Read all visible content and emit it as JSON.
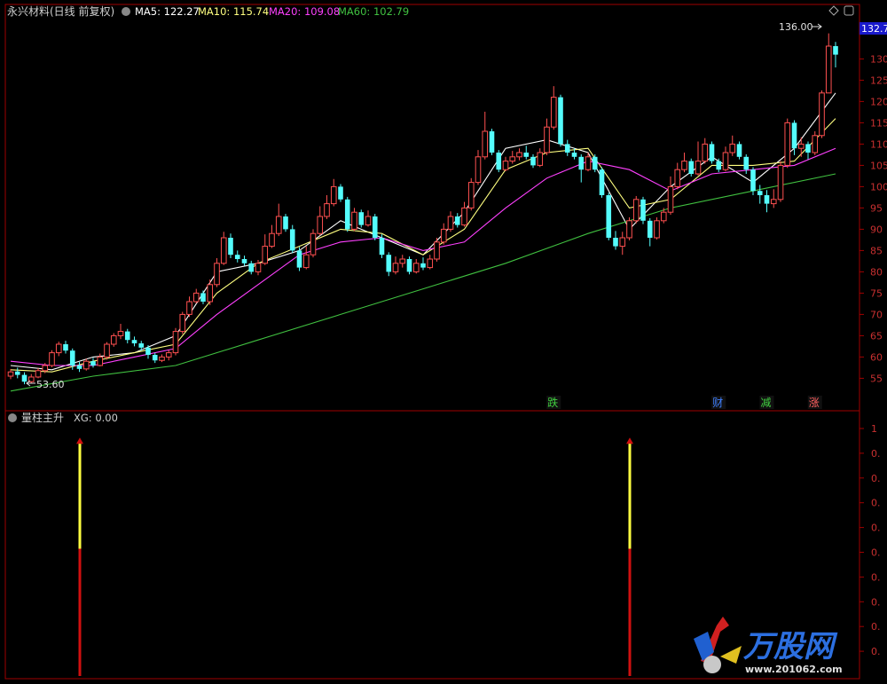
{
  "header": {
    "title": "永兴材料(日线 前复权)",
    "ma5": "MA5: 122.27",
    "ma10": "MA10: 115.74",
    "ma20": "MA20: 109.08",
    "ma60": "MA60: 102.79"
  },
  "indicator_header": {
    "title": "量柱主升",
    "xg": "XG: 0.00"
  },
  "price_tag": "132.7",
  "annotations": {
    "high_label": "136.00",
    "low_label": "53.60"
  },
  "event_markers": [
    "跌",
    "财",
    "减",
    "涨"
  ],
  "watermark": {
    "brand": "万股网",
    "url": "www.201062.com"
  },
  "colors": {
    "up": "#ff5050",
    "down": "#54fcfc",
    "ma5": "#ffffff",
    "ma10": "#ffff80",
    "ma20": "#ff40ff",
    "ma60": "#40c040",
    "axis": "#a00000",
    "bar_top": "#ffff40",
    "bar_bottom": "#d01010"
  },
  "chart_data": [
    {
      "type": "candlestick",
      "title": "永兴材料(日线 前复权)",
      "ylim": [
        48,
        138
      ],
      "y_ticks": [
        55,
        60,
        65,
        70,
        75,
        80,
        85,
        90,
        95,
        100,
        105,
        110,
        115,
        120,
        125,
        130
      ],
      "y_tick_labels": [
        "55",
        "60",
        "65",
        "70",
        "75",
        "80",
        "85",
        "90",
        "95",
        "100",
        "105",
        "110",
        "115",
        "120",
        "125",
        "130"
      ],
      "grid": false,
      "candles": [
        [
          55.5,
          56.5,
          54.8,
          57.2
        ],
        [
          56.6,
          55.8,
          55.0,
          57.5
        ],
        [
          55.8,
          54.2,
          53.6,
          56.4
        ],
        [
          54.2,
          55.3,
          53.8,
          56.0
        ],
        [
          55.3,
          56.8,
          55.0,
          57.4
        ],
        [
          56.8,
          58.0,
          56.2,
          58.6
        ],
        [
          58.0,
          61.0,
          57.6,
          61.6
        ],
        [
          61.0,
          63.0,
          60.2,
          63.6
        ],
        [
          63.0,
          61.5,
          60.8,
          63.8
        ],
        [
          61.5,
          58.0,
          57.0,
          62.0
        ],
        [
          58.0,
          57.2,
          56.5,
          58.8
        ],
        [
          57.2,
          59.0,
          56.8,
          59.6
        ],
        [
          59.0,
          58.0,
          57.5,
          59.8
        ],
        [
          58.0,
          60.0,
          57.8,
          60.8
        ],
        [
          60.0,
          63.0,
          59.4,
          63.5
        ],
        [
          63.0,
          65.0,
          62.4,
          65.6
        ],
        [
          65.0,
          66.0,
          64.2,
          67.8
        ],
        [
          66.0,
          64.0,
          63.2,
          66.6
        ],
        [
          64.0,
          63.2,
          62.5,
          64.8
        ],
        [
          63.2,
          62.2,
          61.5,
          63.8
        ],
        [
          62.2,
          60.5,
          59.6,
          62.8
        ],
        [
          60.5,
          59.2,
          58.6,
          61.0
        ],
        [
          59.2,
          60.0,
          58.8,
          60.6
        ],
        [
          60.0,
          61.0,
          59.2,
          61.6
        ],
        [
          61.0,
          66.0,
          60.4,
          66.8
        ],
        [
          66.0,
          70.0,
          65.4,
          70.6
        ],
        [
          70.0,
          73.0,
          69.4,
          74.2
        ],
        [
          73.0,
          75.0,
          72.6,
          76.0
        ],
        [
          75.0,
          73.0,
          72.4,
          75.6
        ],
        [
          73.0,
          77.0,
          72.2,
          78.2
        ],
        [
          77.0,
          82.0,
          76.4,
          83.2
        ],
        [
          82.0,
          88.0,
          81.6,
          89.4
        ],
        [
          88.0,
          84.0,
          83.2,
          89.0
        ],
        [
          84.0,
          83.0,
          82.2,
          85.0
        ],
        [
          83.0,
          82.0,
          81.4,
          83.8
        ],
        [
          82.0,
          80.0,
          79.4,
          82.6
        ],
        [
          80.0,
          82.0,
          79.2,
          82.8
        ],
        [
          82.0,
          86.0,
          81.6,
          88.8
        ],
        [
          86.0,
          89.0,
          85.6,
          91.0
        ],
        [
          89.0,
          93.0,
          88.4,
          96.0
        ],
        [
          93.0,
          90.0,
          89.4,
          93.6
        ],
        [
          90.0,
          85.0,
          84.4,
          91.0
        ],
        [
          85.0,
          81.0,
          80.2,
          85.8
        ],
        [
          81.0,
          84.0,
          80.6,
          86.0
        ],
        [
          84.0,
          89.0,
          83.4,
          90.0
        ],
        [
          89.0,
          93.0,
          88.6,
          95.4
        ],
        [
          93.0,
          96.0,
          92.4,
          98.0
        ],
        [
          96.0,
          100.0,
          95.4,
          101.8
        ],
        [
          100.0,
          97.0,
          96.4,
          100.6
        ],
        [
          97.0,
          90.0,
          89.4,
          97.6
        ],
        [
          90.0,
          94.0,
          89.6,
          95.0
        ],
        [
          94.0,
          91.0,
          90.4,
          94.6
        ],
        [
          91.0,
          93.0,
          90.6,
          94.4
        ],
        [
          93.0,
          88.0,
          87.4,
          93.6
        ],
        [
          88.0,
          84.0,
          83.2,
          88.8
        ],
        [
          84.0,
          80.0,
          79.0,
          84.6
        ],
        [
          80.0,
          82.0,
          79.4,
          83.6
        ],
        [
          82.0,
          83.0,
          81.0,
          84.0
        ],
        [
          83.0,
          80.0,
          79.4,
          83.6
        ],
        [
          80.0,
          82.0,
          79.6,
          83.0
        ],
        [
          82.0,
          81.0,
          80.4,
          83.4
        ],
        [
          81.0,
          83.0,
          80.6,
          84.0
        ],
        [
          83.0,
          87.0,
          82.4,
          88.0
        ],
        [
          87.0,
          90.0,
          86.4,
          91.4
        ],
        [
          90.0,
          93.0,
          89.4,
          94.2
        ],
        [
          93.0,
          91.0,
          90.4,
          93.8
        ],
        [
          91.0,
          95.0,
          90.6,
          96.4
        ],
        [
          95.0,
          101.0,
          94.4,
          102.0
        ],
        [
          101.0,
          107.0,
          100.4,
          108.6
        ],
        [
          107.0,
          113.0,
          106.4,
          117.6
        ],
        [
          113.0,
          108.0,
          107.4,
          113.6
        ],
        [
          108.0,
          104.0,
          103.4,
          108.6
        ],
        [
          104.0,
          106.0,
          103.6,
          107.0
        ],
        [
          106.0,
          107.0,
          105.4,
          108.4
        ],
        [
          107.0,
          108.0,
          106.2,
          109.0
        ],
        [
          108.0,
          107.0,
          106.4,
          109.6
        ],
        [
          107.0,
          105.0,
          104.4,
          107.6
        ],
        [
          105.0,
          108.0,
          104.6,
          109.0
        ],
        [
          108.0,
          114.0,
          107.4,
          116.0
        ],
        [
          114.0,
          121.0,
          113.4,
          123.6
        ],
        [
          121.0,
          110.0,
          109.4,
          121.6
        ],
        [
          110.0,
          108.0,
          107.2,
          111.0
        ],
        [
          108.0,
          107.0,
          106.4,
          109.0
        ],
        [
          107.0,
          104.0,
          101.0,
          107.6
        ],
        [
          104.0,
          107.0,
          103.6,
          108.0
        ],
        [
          107.0,
          104.0,
          103.4,
          107.6
        ],
        [
          104.0,
          98.0,
          97.4,
          104.6
        ],
        [
          98.0,
          88.0,
          87.4,
          98.6
        ],
        [
          88.0,
          86.0,
          85.2,
          89.6
        ],
        [
          86.0,
          88.0,
          84.0,
          89.4
        ],
        [
          88.0,
          92.0,
          87.4,
          92.8
        ],
        [
          92.0,
          97.0,
          91.4,
          97.8
        ],
        [
          97.0,
          92.0,
          91.2,
          97.6
        ],
        [
          92.0,
          88.0,
          86.0,
          92.6
        ],
        [
          88.0,
          92.0,
          87.6,
          92.8
        ],
        [
          92.0,
          94.0,
          91.4,
          95.0
        ],
        [
          94.0,
          100.0,
          93.4,
          102.4
        ],
        [
          100.0,
          104.0,
          99.4,
          105.6
        ],
        [
          104.0,
          106.0,
          103.4,
          108.0
        ],
        [
          106.0,
          103.0,
          102.4,
          106.6
        ],
        [
          103.0,
          106.0,
          102.6,
          110.6
        ],
        [
          106.0,
          110.0,
          105.4,
          111.4
        ],
        [
          110.0,
          106.0,
          105.4,
          110.6
        ],
        [
          106.0,
          104.0,
          103.4,
          106.6
        ],
        [
          104.0,
          108.0,
          103.6,
          109.4
        ],
        [
          108.0,
          110.0,
          107.2,
          112.0
        ],
        [
          110.0,
          107.0,
          106.4,
          110.6
        ],
        [
          107.0,
          104.0,
          103.0,
          107.6
        ],
        [
          104.0,
          99.0,
          98.0,
          104.6
        ],
        [
          99.0,
          98.0,
          96.0,
          100.4
        ],
        [
          98.0,
          96.0,
          94.0,
          99.2
        ],
        [
          96.0,
          97.0,
          95.0,
          99.4
        ],
        [
          97.0,
          105.0,
          96.4,
          106.0
        ],
        [
          105.0,
          115.0,
          104.4,
          116.0
        ],
        [
          115.0,
          109.0,
          107.4,
          115.6
        ],
        [
          109.0,
          110.0,
          107.0,
          111.6
        ],
        [
          110.0,
          108.0,
          106.4,
          110.6
        ],
        [
          108.0,
          112.0,
          107.4,
          113.0
        ],
        [
          112.0,
          122.0,
          111.4,
          122.6
        ],
        [
          122.0,
          133.0,
          125.0,
          136.0
        ],
        [
          133.0,
          131.0,
          128.0,
          134.0
        ]
      ],
      "ma_series": [
        {
          "name": "MA5",
          "values_at": [
            [
              0,
              58
            ],
            [
              6,
              57
            ],
            [
              12,
              60
            ],
            [
              18,
              61
            ],
            [
              24,
              65
            ],
            [
              30,
              80
            ],
            [
              36,
              82
            ],
            [
              42,
              85
            ],
            [
              48,
              92
            ],
            [
              54,
              88
            ],
            [
              60,
              84
            ],
            [
              66,
              94
            ],
            [
              72,
              109
            ],
            [
              78,
              111
            ],
            [
              84,
              108
            ],
            [
              90,
              90
            ],
            [
              96,
              100
            ],
            [
              102,
              107
            ],
            [
              108,
              101
            ],
            [
              114,
              109
            ],
            [
              120,
              122
            ]
          ]
        },
        {
          "name": "MA10",
          "values_at": [
            [
              0,
              57
            ],
            [
              6,
              56.5
            ],
            [
              12,
              59
            ],
            [
              18,
              61
            ],
            [
              24,
              63
            ],
            [
              30,
              75
            ],
            [
              36,
              82
            ],
            [
              42,
              86
            ],
            [
              48,
              90
            ],
            [
              54,
              89
            ],
            [
              60,
              84
            ],
            [
              66,
              90
            ],
            [
              72,
              104
            ],
            [
              78,
              108
            ],
            [
              84,
              109
            ],
            [
              90,
              95
            ],
            [
              96,
              97
            ],
            [
              102,
              105
            ],
            [
              108,
              105
            ],
            [
              114,
              106
            ],
            [
              120,
              116
            ]
          ]
        },
        {
          "name": "MA20",
          "values_at": [
            [
              0,
              59
            ],
            [
              6,
              58
            ],
            [
              12,
              58
            ],
            [
              18,
              60
            ],
            [
              24,
              62
            ],
            [
              30,
              70
            ],
            [
              36,
              77
            ],
            [
              42,
              84
            ],
            [
              48,
              87
            ],
            [
              54,
              88
            ],
            [
              60,
              85
            ],
            [
              66,
              87
            ],
            [
              72,
              95
            ],
            [
              78,
              102
            ],
            [
              84,
              106
            ],
            [
              90,
              104
            ],
            [
              96,
              99
            ],
            [
              102,
              103
            ],
            [
              108,
              104
            ],
            [
              114,
              105
            ],
            [
              120,
              109
            ]
          ]
        },
        {
          "name": "MA60",
          "values_at": [
            [
              0,
              52
            ],
            [
              12,
              55.5
            ],
            [
              24,
              58
            ],
            [
              36,
              64
            ],
            [
              48,
              70
            ],
            [
              60,
              76
            ],
            [
              72,
              82
            ],
            [
              84,
              89
            ],
            [
              96,
              95
            ],
            [
              108,
              99
            ],
            [
              120,
              103
            ]
          ]
        }
      ],
      "high_annotation": {
        "value": 136.0,
        "candle_index": 119
      },
      "low_annotation": {
        "value": 53.6,
        "candle_index": 2
      },
      "event_marker_candle_index": [
        79,
        103,
        110,
        117
      ]
    },
    {
      "type": "bar",
      "title": "量柱主升",
      "ylim": [
        0,
        1.05
      ],
      "y_tick_labels": [
        "1",
        "0.",
        "0.",
        "0.",
        "0.",
        "0.",
        "0.",
        "0.",
        "0.",
        "0."
      ],
      "signal_bars": [
        {
          "candle_index": 10,
          "value": 1.0,
          "top_segment_fraction": 0.46
        },
        {
          "candle_index": 90,
          "value": 1.0,
          "top_segment_fraction": 0.46
        }
      ]
    }
  ]
}
